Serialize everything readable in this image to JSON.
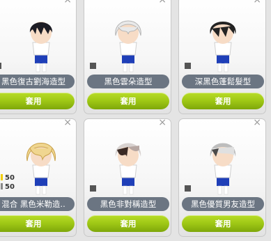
{
  "close_icon": "×",
  "apply_label": "套用",
  "cards": [
    {
      "name": "黑色復古劉海造型",
      "hair": "#1d1d25"
    },
    {
      "name": "黑色雲朵造型",
      "hair": "#e9e9e9"
    },
    {
      "name": "深黑色蓬鬆髮型",
      "hair": "#232323"
    },
    {
      "name": "混合 黑色米勒造..",
      "hair": "#f0d690",
      "stats": [
        "50",
        "50"
      ]
    },
    {
      "name": "黑色非對稱造型",
      "hair": "#b7a7a2"
    },
    {
      "name": "黑色優質男友造型",
      "hair": "#bdbdbd"
    }
  ]
}
